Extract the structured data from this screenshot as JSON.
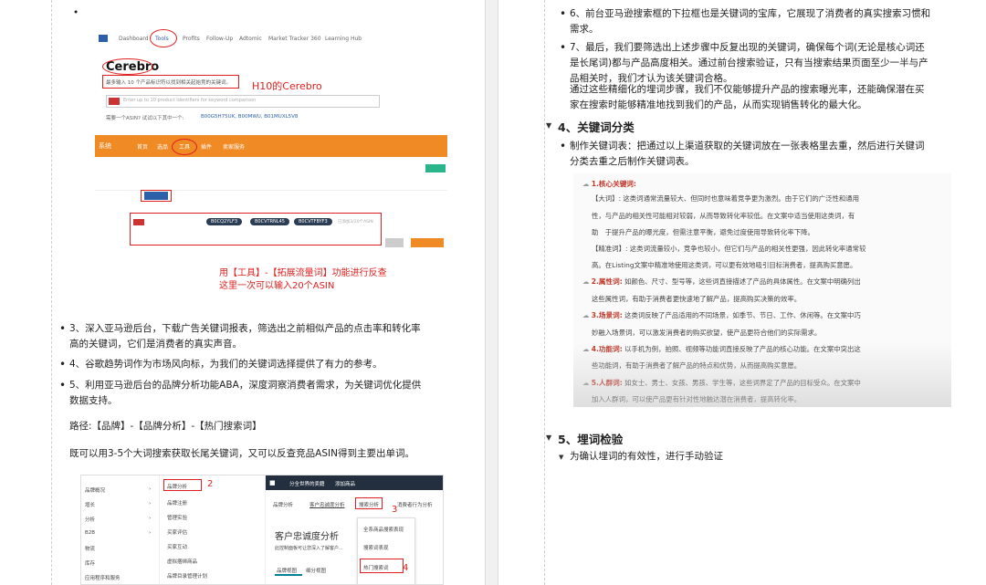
{
  "left": {
    "screenshot1": {
      "nav": [
        "Dashboard",
        "Tools",
        "Profits",
        "Follow-Up",
        "Adtomic",
        "Market Tracker 360",
        "Learning Hub"
      ],
      "cerebro_title": "Cerebro",
      "cerebro_desc": "最多输入 10 个产品标识符以找到相关起始竞的关键词。",
      "search_placeholder": "Enter up to 10 product identifiers for keyword comparison",
      "example_label": "需要一个ASIN? 试试以下其中一个:",
      "example_asins": "B00G5H75UK, B00MWU, B01MUXL5V8",
      "annotation": "H10的Cerebro",
      "orange_tabs": [
        "系统",
        "首页",
        "选品",
        "工具",
        "插件",
        "卖家服务"
      ],
      "chips": [
        "B0CQ2YLF3",
        "B0CVTRNL45",
        "B0CVTFBYF3"
      ],
      "input_hint": "已添加3/20个ASIN",
      "caption_line1": "用【工具】-【拓展流量词】功能进行反查",
      "caption_line2": "这里一次可以输入20个ASIN"
    },
    "bullets": [
      "3、深入亚马逊后台，下载广告关键词报表，筛选出之前相似产品的点击率和转化率高的关键词，它们是消费者的真实声音。",
      "4、谷歌趋势词作为市场风向标，为我们的关键词选择提供了有力的参考。",
      "5、利用亚马逊后台的品牌分析功能ABA，深度洞察消费者需求，为关键词优化提供数据支持。"
    ],
    "path_text": "路径:【品牌】-【品牌分析】-【热门搜索词】",
    "summary_text": "既可以用3-5个大词搜索获取长尾关键词，又可以反查竞品ASIN得到主要出单词。",
    "screenshot2": {
      "sidebar_items": [
        "品牌概况",
        "增长",
        "分析",
        "B2B",
        "物流",
        "库存",
        "应用程序和服务",
        "B2B"
      ],
      "submenu_items": [
        "品牌分析",
        "品牌注册",
        "管理实验",
        "买家评估",
        "买家互动",
        "虚拟捆绑商品",
        "品牌目录管理计划"
      ],
      "top_bar": [
        "分全世界的卖籍",
        "添加商品"
      ],
      "breadcrumb": [
        "品牌分析",
        "客户忠诚度分析",
        "搜索分析",
        "消费者行为分析"
      ],
      "dropdown_items": [
        "全系商品搜索表现",
        "搜索词表现",
        "热门搜索词"
      ],
      "page_title": "客户忠诚度分析",
      "page_desc": "此控制面板可让您深入了解客户...",
      "tabs": [
        "品牌视图",
        "细分视图"
      ],
      "num2": "2",
      "num3": "3",
      "num4": "4"
    }
  },
  "right": {
    "bullets_top": [
      "6、前台亚马逊搜索框的下拉框也是关键词的宝库，它展现了消费者的真实搜索习惯和需求。",
      "7、最后，我们要筛选出上述步骤中反复出现的关键词，确保每个词(无论是核心词还是长尾词)都与产品高度相关。通过前台搜索验证，只有当搜索结果页面至少一半与产品相关时，我们才认为该关键词合格。"
    ],
    "continuation": "通过这些精细化的埋词步骤，我们不仅能够提升产品的搜索曝光率，还能确保潜在买家在搜索时能够精准地找到我们的产品，从而实现销售转化的最大化。",
    "heading4": "4、关键词分类",
    "bullet4": "制作关键词表：把通过以上渠道获取的关键词放在一张表格里去重，然后进行关键词分类去重之后制作关键词表。",
    "kw_image_lines": [
      {
        "type": "head",
        "text": "1.核心关键词:"
      },
      {
        "type": "text",
        "text": "【大词】: 这类词通常流量较大、但同时也意味着竞争更为激烈。由于它们的广泛性和通用"
      },
      {
        "type": "text",
        "text": "性，与产品的相关性可能相对较弱，从而导致转化率较低。在文案中适当使用这类词，有"
      },
      {
        "type": "text",
        "text": "助　于提升产品的曝光度，但需注意平衡，避免过度使用导致转化率下降。"
      },
      {
        "type": "text",
        "text": "【精准词】: 这类词流量较小，竞争也较小，但它们与产品的相关性更强，因此转化率通常较"
      },
      {
        "type": "text",
        "text": "高。在Listing文案中精准地使用这类词，可以更有效地吸引目标消费者，提高购买意愿。"
      },
      {
        "type": "headline",
        "head": "2.属性词:",
        "text": " 如颜色、尺寸、型号等，这些词直接描述了产品的具体属性。在文案中明确列出"
      },
      {
        "type": "text",
        "text": "这些属性词，有助于消费者更快速地了解产品，提高购买决策的效率。"
      },
      {
        "type": "headline",
        "head": "3.场景词:",
        "text": " 这类词反映了产品适用的不同场景，如季节、节日、工作、休闲等。在文案中巧"
      },
      {
        "type": "text",
        "text": "妙融入场景词，可以激发消费者的购买欲望，使产品更符合他们的实际需求。"
      },
      {
        "type": "headline",
        "head": "4.功能词:",
        "text": " 以手机为例，拍照、视频等功能词直接反映了产品的核心功能。在文案中突出这"
      },
      {
        "type": "text",
        "text": "些功能词，有助于消费者了解产品的特点和优势，从而提高购买意愿。"
      },
      {
        "type": "headline",
        "head": "5.人群词:",
        "text": " 如女士、男士、女孩、男孩、学生等，这些词界定了产品的目标受众。在文案中"
      },
      {
        "type": "text",
        "text": "加入人群词，可以使产品更有针对性地触达潜在消费者，提高转化率。"
      }
    ],
    "heading5": "5、埋词检验",
    "bullet5": "为确认埋词的有效性，进行手动验证"
  }
}
